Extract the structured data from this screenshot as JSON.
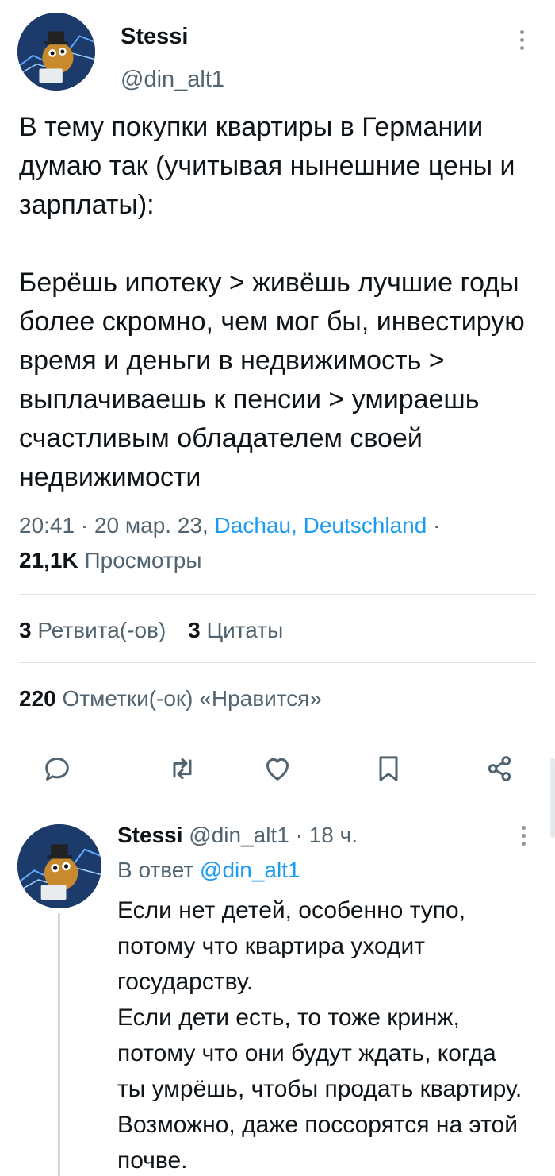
{
  "tweet": {
    "author_name": "Stessi",
    "author_handle": "@din_alt1",
    "text": "В тему покупки квартиры в Германии думаю так (учитывая нынешние цены и зарплаты):\n\nБерёшь ипотеку > живёшь лучшие годы более скромно, чем мог бы, инвестирую время и деньги в недвижимость > выплачиваешь к пенсии > умираешь счастливым обладателем своей недвижимости",
    "time_date": "20:41 · 20 мар. 23,",
    "location": "Dachau, Deutschland",
    "location_suffix": " ·",
    "views_count": "21,1K",
    "views_label": "Просмотры",
    "retweets_count": "3",
    "retweets_label": "Ретвита(-ов)",
    "quotes_count": "3",
    "quotes_label": "Цитаты",
    "likes_count": "220",
    "likes_label": "Отметки(-ок) «Нравится»"
  },
  "actions": {
    "icons": [
      "reply-icon",
      "retweet-icon",
      "like-icon",
      "bookmark-icon",
      "share-icon"
    ]
  },
  "reply": {
    "author_name": "Stessi",
    "author_handle": "@din_alt1",
    "time": "· 18 ч.",
    "reply_to_label": "В ответ",
    "reply_to_handle": "@din_alt1",
    "text": "Если нет детей, особенно тупо, потому что квартира уходит государству.\nЕсли дети есть, то тоже кринж, потому что они будут ждать, когда ты умрёшь, чтобы продать квартиру. Возможно, даже поссорятся на этой почве."
  },
  "colors": {
    "text": "#0f1419",
    "secondary": "#536471",
    "link": "#1d9bf0",
    "divider": "#dde3e8"
  }
}
